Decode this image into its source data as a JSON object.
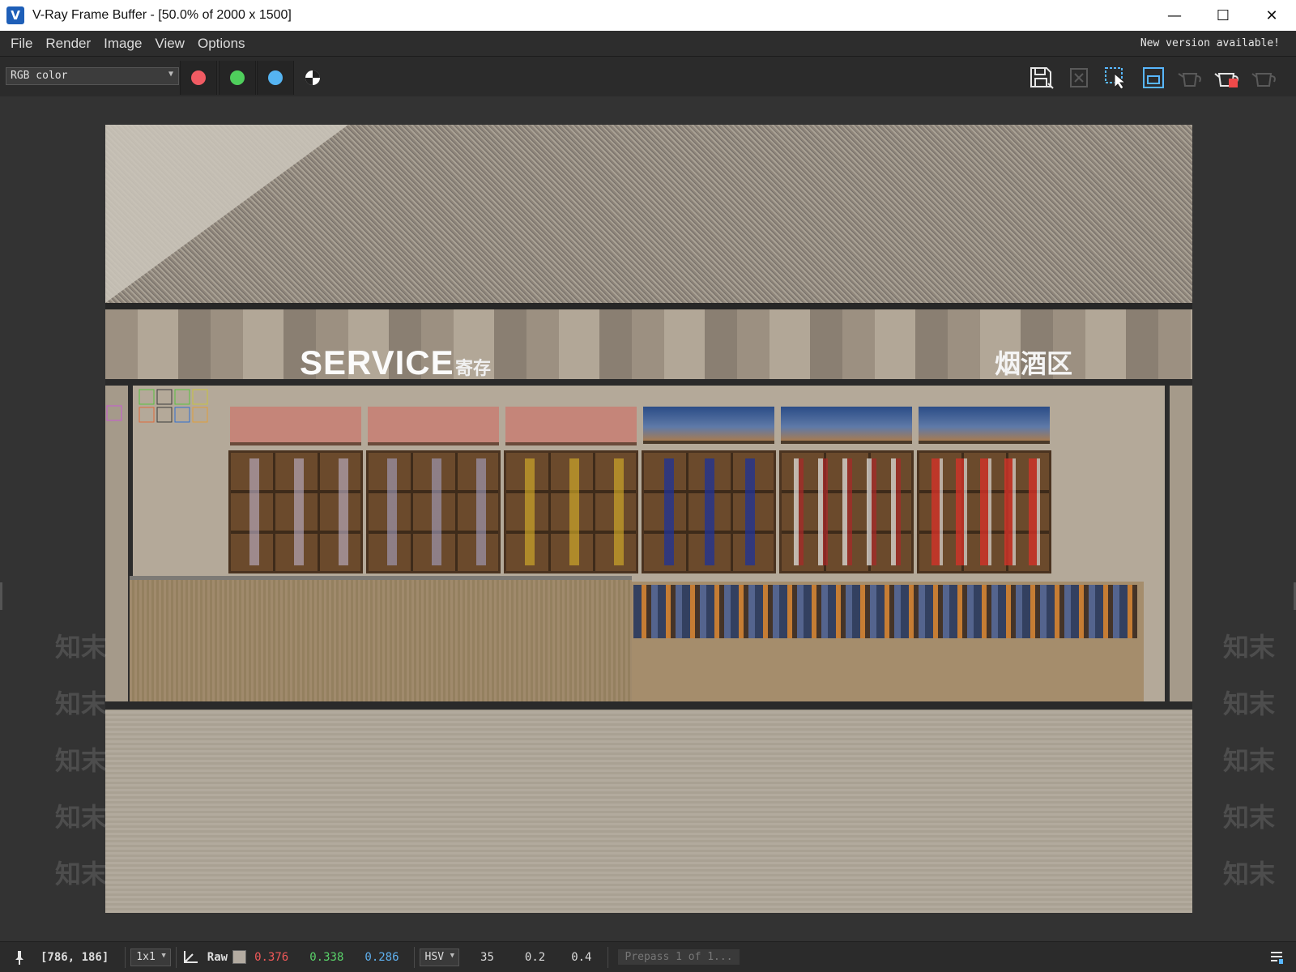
{
  "window": {
    "title": "V-Ray Frame Buffer - [50.0% of 2000 x 1500]",
    "minimize": "—",
    "maximize": "☐",
    "close": "✕"
  },
  "menu": {
    "items": [
      "File",
      "Render",
      "Image",
      "View",
      "Options"
    ],
    "notice": "New version available!"
  },
  "toolbar": {
    "channel": "RGB color",
    "channel_buttons": [
      {
        "name": "red-channel",
        "color": "#f15b63"
      },
      {
        "name": "green-channel",
        "color": "#4fcf5c"
      },
      {
        "name": "blue-channel",
        "color": "#55b4f2"
      },
      {
        "name": "alpha-channel",
        "color": "#ffffff"
      }
    ],
    "tools": [
      "save-icon",
      "clear-image-icon",
      "region-render-icon",
      "track-mouse-icon",
      "render-last-disabled-icon",
      "stop-render-icon",
      "render-icon"
    ]
  },
  "render": {
    "sign_service": "SERVICE",
    "sign_service_cn": "寄存",
    "sign_right": "烟酒区"
  },
  "watermark": {
    "text": "知末"
  },
  "status": {
    "coords": "[786, 186]",
    "scale": "1x1",
    "mode": "Raw",
    "r": "0.376",
    "g": "0.338",
    "b": "0.286",
    "color_space": "HSV",
    "h": "35",
    "s": "0.2",
    "v": "0.4",
    "progress": "Prepass 1 of 1...",
    "colors": {
      "r": "#f25959",
      "g": "#5ad36a",
      "b": "#5fb1f0"
    }
  }
}
